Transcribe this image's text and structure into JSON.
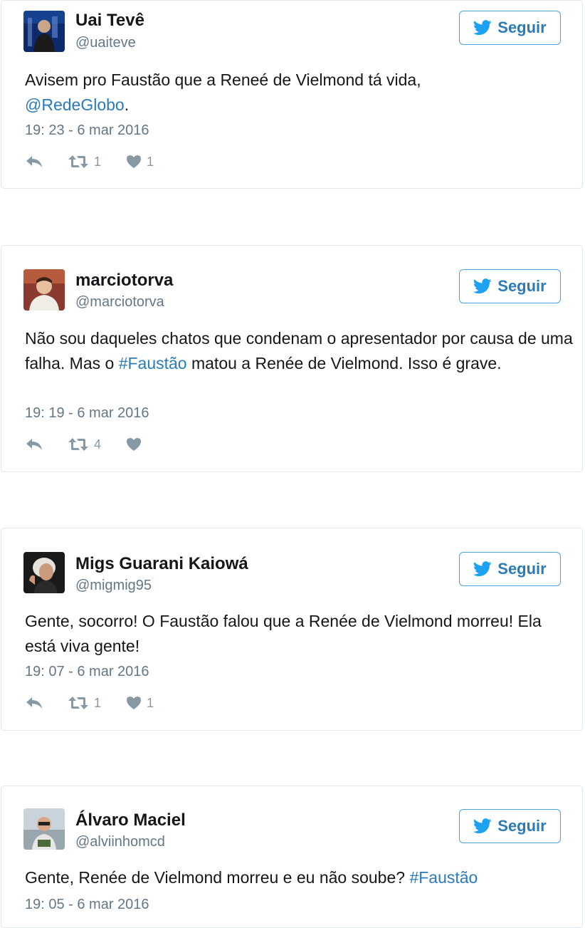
{
  "colors": {
    "link": "#2b7bb9",
    "follow_border": "#4aa3df",
    "muted": "#8899a6",
    "card_border": "#e1e8ed"
  },
  "icons": {
    "follow": "twitter-bird-icon",
    "reply": "reply-icon",
    "retweet": "retweet-icon",
    "like": "heart-icon"
  },
  "tweets": [
    {
      "name": "Uai Tevê",
      "handle": "@uaiteve",
      "follow_label": "Seguir",
      "text_before": "Avisem pro Faustão que a Reneé de Vielmond tá vida,",
      "link": "@RedeGlobo",
      "text_after": ".",
      "time": "19: 23 - 6 mar 2016",
      "retweets": "1",
      "likes": "1"
    },
    {
      "name": "marciotorva",
      "handle": "@marciotorva",
      "follow_label": "Seguir",
      "text_before": "Não sou daqueles chatos que condenam o apresentador por causa de uma falha. Mas o ",
      "link": "#Faustão",
      "text_after": " matou a Renée de Vielmond. Isso é grave.",
      "time": "19: 19 - 6 mar 2016",
      "retweets": "4",
      "likes": ""
    },
    {
      "name": "Migs Guarani Kaiowá",
      "handle": "@migmig95",
      "follow_label": "Seguir",
      "text_before": "Gente, socorro! O Faustão falou que a Renée de Vielmond morreu! Ela está viva gente!",
      "link": "",
      "text_after": "",
      "time": "19: 07 - 6 mar 2016",
      "retweets": "1",
      "likes": "1"
    },
    {
      "name": "Álvaro Maciel",
      "handle": "@alviinhomcd",
      "follow_label": "Seguir",
      "text_before": "Gente, Renée de Vielmond morreu e eu não soube? ",
      "link": "#Faustão",
      "text_after": "",
      "time": "19: 05 - 6 mar 2016"
    }
  ]
}
